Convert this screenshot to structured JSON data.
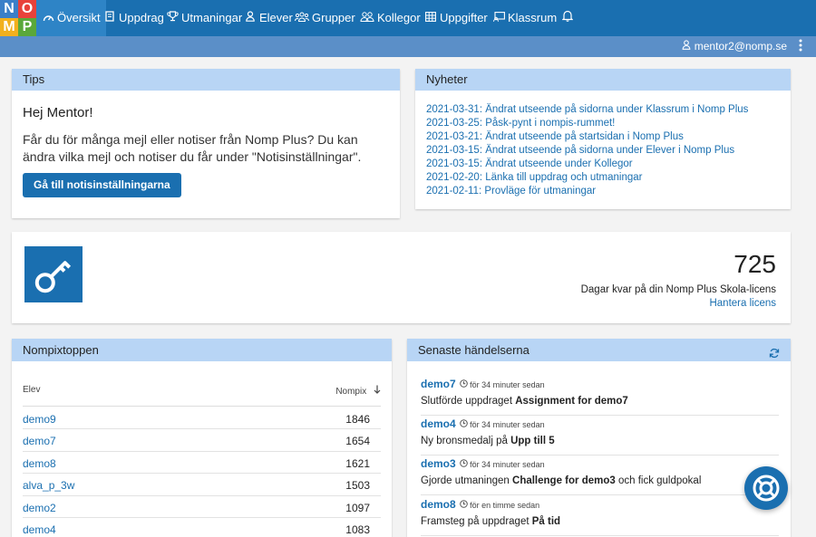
{
  "nav": {
    "logo_letters": [
      "N",
      "O",
      "M",
      "P"
    ],
    "items": [
      {
        "label": "Översikt",
        "icon": "dashboard-icon"
      },
      {
        "label": "Uppdrag",
        "icon": "book-icon"
      },
      {
        "label": "Utmaningar",
        "icon": "trophy-icon"
      },
      {
        "label": "Elever",
        "icon": "user-icon"
      },
      {
        "label": "Grupper",
        "icon": "group-icon"
      },
      {
        "label": "Kollegor",
        "icon": "colleagues-icon"
      },
      {
        "label": "Uppgifter",
        "icon": "grid-icon"
      },
      {
        "label": "Klassrum",
        "icon": "classroom-icon"
      }
    ],
    "bell_icon": "bell-icon"
  },
  "user": {
    "email": "mentor2@nomp.se"
  },
  "tips": {
    "title": "Tips",
    "greeting": "Hej Mentor!",
    "text": "Får du för många mejl eller notiser från Nomp Plus? Du kan ändra vilka mejl och notiser du får under \"Notisinställningar\".",
    "button": "Gå till notisinställningarna"
  },
  "news": {
    "title": "Nyheter",
    "items": [
      "2021-03-31: Ändrat utseende på sidorna under Klassrum i Nomp Plus",
      "2021-03-25: Påsk-pynt i nompis-rummet!",
      "2021-03-21: Ändrat utseende på startsidan i Nomp Plus",
      "2021-03-15: Ändrat utseende på sidorna under Elever i Nomp Plus",
      "2021-03-15: Ändrat utseende under Kollegor",
      "2021-02-20: Länka till uppdrag och utmaningar",
      "2021-02-11: Provläge för utmaningar"
    ]
  },
  "license": {
    "days": "725",
    "label": "Dagar kvar på din Nomp Plus Skola-licens",
    "manage": "Hantera licens"
  },
  "top": {
    "title": "Nompixtoppen",
    "col_student": "Elev",
    "col_nompix": "Nompix",
    "rows": [
      {
        "name": "demo9",
        "value": "1846"
      },
      {
        "name": "demo7",
        "value": "1654"
      },
      {
        "name": "demo8",
        "value": "1621"
      },
      {
        "name": "alva_p_3w",
        "value": "1503"
      },
      {
        "name": "demo2",
        "value": "1097"
      },
      {
        "name": "demo4",
        "value": "1083"
      }
    ]
  },
  "events": {
    "title": "Senaste händelserna",
    "items": [
      {
        "who": "demo7",
        "when": "för 34 minuter sedan",
        "pre": "Slutförde uppdraget ",
        "bold": "Assignment for demo7",
        "post": ""
      },
      {
        "who": "demo4",
        "when": "för 34 minuter sedan",
        "pre": "Ny bronsmedalj på ",
        "bold": "Upp till 5",
        "post": ""
      },
      {
        "who": "demo3",
        "when": "för 34 minuter sedan",
        "pre": "Gjorde utmaningen ",
        "bold": "Challenge for demo3",
        "post": " och fick guldpokal"
      },
      {
        "who": "demo8",
        "when": "för en timme sedan",
        "pre": "Framsteg på uppdraget ",
        "bold": "På tid",
        "post": ""
      }
    ]
  }
}
